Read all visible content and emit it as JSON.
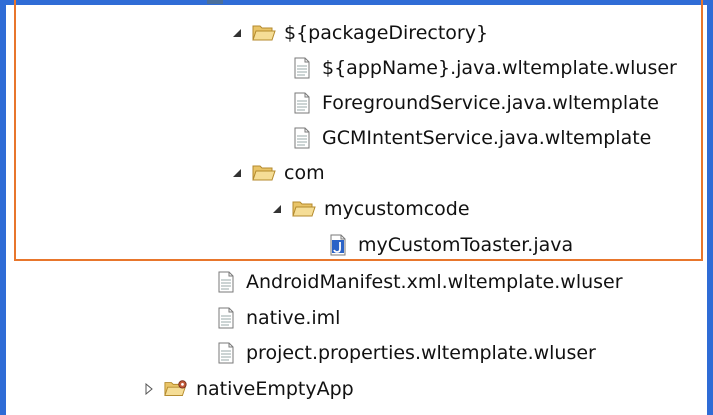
{
  "tree": {
    "items": [
      {
        "label": "${packageDirectory}",
        "icon": "folder-open-icon",
        "twisty": "expanded"
      },
      {
        "label": "${appName}.java.wltemplate.wluser",
        "icon": "text-file-icon"
      },
      {
        "label": "ForegroundService.java.wltemplate",
        "icon": "text-file-icon"
      },
      {
        "label": "GCMIntentService.java.wltemplate",
        "icon": "text-file-icon"
      },
      {
        "label": "com",
        "icon": "folder-open-icon",
        "twisty": "expanded"
      },
      {
        "label": "mycustomcode",
        "icon": "folder-open-icon",
        "twisty": "expanded"
      },
      {
        "label": "myCustomToaster.java",
        "icon": "java-file-icon"
      },
      {
        "label": "AndroidManifest.xml.wltemplate.wluser",
        "icon": "text-file-icon"
      },
      {
        "label": "native.iml",
        "icon": "text-file-icon"
      },
      {
        "label": "project.properties.wltemplate.wluser",
        "icon": "text-file-icon"
      },
      {
        "label": "nativeEmptyApp",
        "icon": "project-folder-icon",
        "twisty": "collapsed"
      }
    ]
  },
  "colors": {
    "highlight_border": "#e8762c",
    "window_frame": "#2f6cd6",
    "folder": "#e9c468",
    "java_badge": "#2b63c7"
  }
}
